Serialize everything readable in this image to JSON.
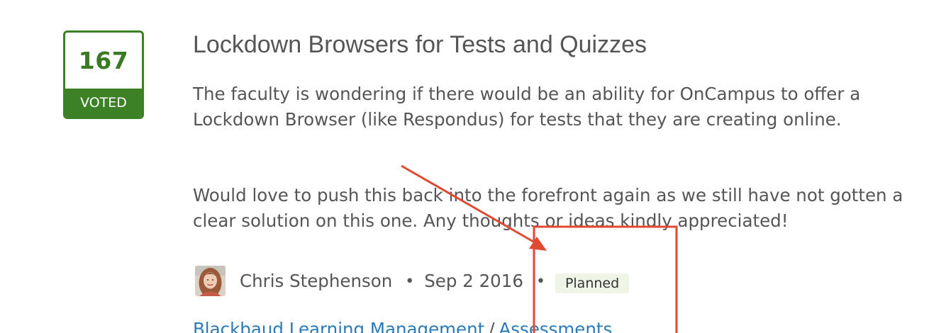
{
  "idea": {
    "votes": "167",
    "vote_status": "VOTED",
    "title": "Lockdown Browsers for Tests and Quizzes",
    "description_1": [
      "The faculty is wondering if there would be an ability for OnCampus to offer a",
      "Lockdown Browser (like Respondus) for tests that they are creating online."
    ],
    "description_2": [
      "Would love to push this back into the forefront again as we still have not gotten a",
      "clear solution on this one.  Any thoughts or ideas kindly appreciated!"
    ],
    "author": "Chris Stephenson",
    "separator": "•",
    "date": "Sep 2 2016",
    "status": "Planned",
    "categories": {
      "primary": "Blackbaud Learning Management",
      "divider": "/",
      "secondary": "Assessments"
    }
  },
  "colors": {
    "accent_green": "#3d8126",
    "annotation_red": "#e04a33",
    "link_blue": "#2a7ab8",
    "badge_bg": "#eef4e6"
  },
  "icons": {
    "avatar": "user-avatar-photo"
  }
}
